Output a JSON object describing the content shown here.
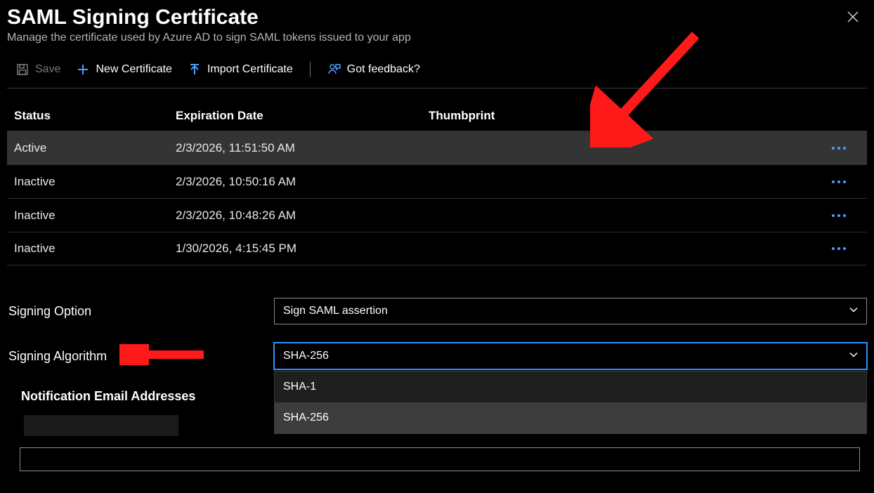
{
  "header": {
    "title": "SAML Signing Certificate",
    "subtitle": "Manage the certificate used by Azure AD to sign SAML tokens issued to your app"
  },
  "toolbar": {
    "save": "Save",
    "new_cert": "New Certificate",
    "import_cert": "Import Certificate",
    "feedback": "Got feedback?"
  },
  "table": {
    "headers": {
      "status": "Status",
      "expiration": "Expiration Date",
      "thumbprint": "Thumbprint"
    },
    "rows": [
      {
        "status": "Active",
        "expiration": "2/3/2026, 11:51:50 AM"
      },
      {
        "status": "Inactive",
        "expiration": "2/3/2026, 10:50:16 AM"
      },
      {
        "status": "Inactive",
        "expiration": "2/3/2026, 10:48:26 AM"
      },
      {
        "status": "Inactive",
        "expiration": "1/30/2026, 4:15:45 PM"
      }
    ]
  },
  "form": {
    "signing_option": {
      "label": "Signing Option",
      "value": "Sign SAML assertion"
    },
    "signing_algorithm": {
      "label": "Signing Algorithm",
      "value": "SHA-256",
      "options": [
        "SHA-1",
        "SHA-256"
      ]
    },
    "notification_emails_label": "Notification Email Addresses"
  }
}
